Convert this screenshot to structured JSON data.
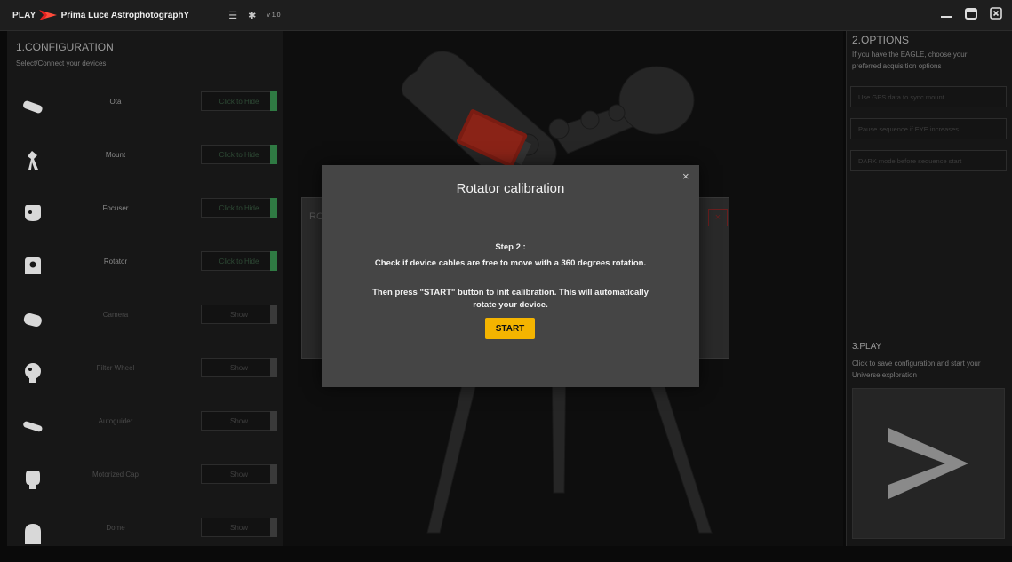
{
  "window": {
    "brand_play": "PLAY",
    "brand_name": "Prima Luce AstrophotographY",
    "version": "v 1.0"
  },
  "configuration": {
    "title": "1.CONFIGURATION",
    "subtitle": "Select/Connect your devices",
    "devices": [
      {
        "label": "Ota",
        "button": "Click to Hide",
        "active": true,
        "icon": "ota-icon"
      },
      {
        "label": "Mount",
        "button": "Click to Hide",
        "active": true,
        "icon": "mount-icon"
      },
      {
        "label": "Focuser",
        "button": "Click to Hide",
        "active": true,
        "icon": "focuser-icon"
      },
      {
        "label": "Rotator",
        "button": "Click to Hide",
        "active": true,
        "icon": "rotator-icon"
      },
      {
        "label": "Camera",
        "button": "Show",
        "active": false,
        "icon": "camera-icon"
      },
      {
        "label": "Filter Wheel",
        "button": "Show",
        "active": false,
        "icon": "filter-wheel-icon"
      },
      {
        "label": "Autoguider",
        "button": "Show",
        "active": false,
        "icon": "autoguider-icon"
      },
      {
        "label": "Motorized Cap",
        "button": "Show",
        "active": false,
        "icon": "motorized-cap-icon"
      },
      {
        "label": "Dome",
        "button": "Show",
        "active": false,
        "icon": "dome-icon"
      }
    ]
  },
  "background_dialog": {
    "title_fragment": "RC"
  },
  "modal": {
    "title": "Rotator calibration",
    "step": "Step 2 :",
    "line1": "Check if device cables are free to move with a 360 degrees rotation.",
    "line2": "Then press \"START\" button to init calibration. This will automatically",
    "line3": "rotate your device.",
    "start_label": "START",
    "close_label": "×"
  },
  "options": {
    "title": "2.OPTIONS",
    "subtitle_line1": "If you have the EAGLE, choose your",
    "subtitle_line2": "preferred acquisition options",
    "buttons": [
      "Use GPS data to sync mount",
      "Pause sequence if EYE increases",
      "DARK mode before sequence start"
    ]
  },
  "play": {
    "title": "3.PLAY",
    "subtitle_line1": "Click to save configuration and start your",
    "subtitle_line2": "Universe exploration"
  },
  "colors": {
    "accent_green": "#2f7a43",
    "start_yellow": "#f4b400",
    "modal_bg": "#454545"
  }
}
